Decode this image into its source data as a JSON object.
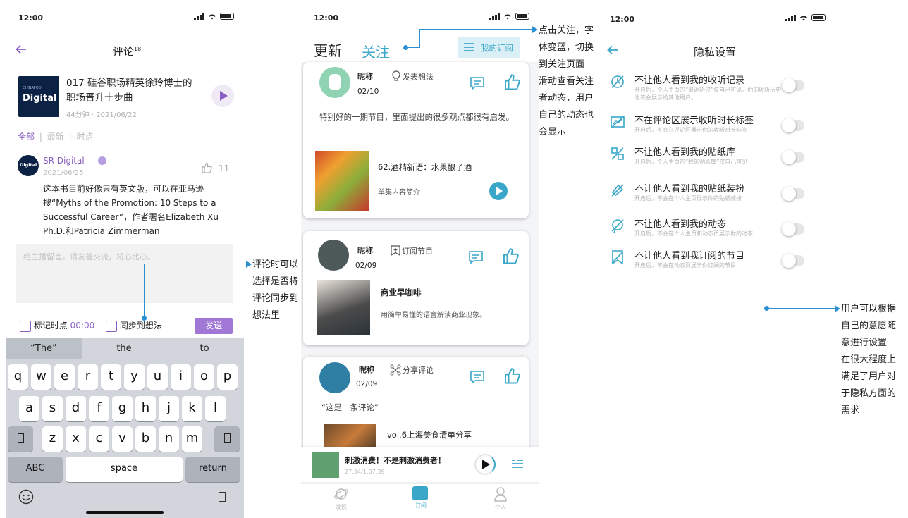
{
  "status": {
    "time": "12:00"
  },
  "screen1": {
    "title": "评论",
    "title_sup": "18",
    "episode": {
      "cover_small": "CHINAPOD",
      "cover_text": "Digital",
      "title_line1": "017 硅谷职场精英徐玲博士的",
      "title_line2": "职场晋升十步曲",
      "meta": "44分钟 · 2021/06/22"
    },
    "filters": [
      "全部",
      "最新",
      "时点"
    ],
    "comment": {
      "avatar_text": "Digital",
      "user": "SR Digital",
      "date": "2021/06/25",
      "likes": "11",
      "lines": [
        "这本书目前好像只有英文版，可以在亚马逊",
        "搜“Myths of the Promotion: 10 Steps to a",
        "Successful Career”，作者署名Elizabeth Xu",
        "Ph.D.和Patricia Zimmerman"
      ]
    },
    "input_placeholder": "给主播留言。请友善交流，将心比心。",
    "mark_time_label": "标记时点",
    "mark_time_value": "00:00",
    "sync_label": "同步到想法",
    "send_label": "发送",
    "keyboard": {
      "suggestions": [
        "“The”",
        "the",
        "to"
      ],
      "row1": [
        "q",
        "w",
        "e",
        "r",
        "t",
        "y",
        "u",
        "i",
        "o",
        "p"
      ],
      "row2": [
        "a",
        "s",
        "d",
        "f",
        "g",
        "h",
        "j",
        "k",
        "l"
      ],
      "row3": [
        "z",
        "x",
        "c",
        "v",
        "b",
        "n",
        "m"
      ],
      "abc": "ABC",
      "space": "space",
      "return": "return"
    }
  },
  "screen2": {
    "tab_update": "更新",
    "tab_follow": "关注",
    "my_sub": "我的订阅",
    "cards": [
      {
        "name": "昵称",
        "date": "02/10",
        "action": "发表想法",
        "text": "特别好的一期节目，里面提出的很多观点都很有启发。",
        "ep_title": "62.酒精新语：水果酿了酒",
        "ep_desc": "单集内容简介"
      },
      {
        "name": "昵称",
        "date": "02/09",
        "action": "订阅节目",
        "ep_title": "商业早咖啡",
        "ep_desc": "用简单易懂的语言解读商业现象。"
      },
      {
        "name": "昵称",
        "date": "02/09",
        "action": "分享评论",
        "quote": "“这是一条评论”",
        "ep_title": "vol.6上海美食清单分享"
      }
    ],
    "player": {
      "title": "刺激消费！不是刺激消费者！",
      "time": "27:34/1:07:39"
    },
    "nav": [
      "发现",
      "订阅",
      "个人"
    ]
  },
  "screen3": {
    "title": "隐私设置",
    "rows": [
      {
        "title": "不让他人看到我的收听记录",
        "desc": "开启后，个人主页的“最近听过”仅自己可见。你的收听历史也不会展示给其他用户。"
      },
      {
        "title": "不在评论区展示收听时长标签",
        "desc": "开启后，不会在评论区展示你的收听时长标签"
      },
      {
        "title": "不让他人看到我的贴纸库",
        "desc": "开启后，个人主页的“我的贴纸库”仅自己可见"
      },
      {
        "title": "不让他人看到我的贴纸装扮",
        "desc": "开启后，不会在个人主页展示你的贴纸装扮"
      },
      {
        "title": "不让他人看到我的动态",
        "desc": "开启后，不会在个人主页和动态页展示你的动态"
      },
      {
        "title": "不让他人看到我订阅的节目",
        "desc": "开启后，不会在动态页展示你订阅的节目"
      }
    ]
  },
  "notes": {
    "comment_note": [
      "评论时可以",
      "选择是否将",
      "评论同步到",
      "想法里"
    ],
    "follow_note": [
      "点击关注，字",
      "体变蓝，切换",
      "到关注页面",
      "滑动查看关注",
      "者动态，用户",
      "自己的动态也",
      "会显示"
    ],
    "privacy_note": [
      "用户可以根据",
      "自己的意愿随",
      "意进行设置",
      "在很大程度上",
      "满足了用户对",
      "于隐私方面的",
      "需求"
    ]
  },
  "colors": {
    "purple": "#8a5fc1",
    "teal": "#3aa7c9",
    "note_blue": "#2b8fd4"
  }
}
